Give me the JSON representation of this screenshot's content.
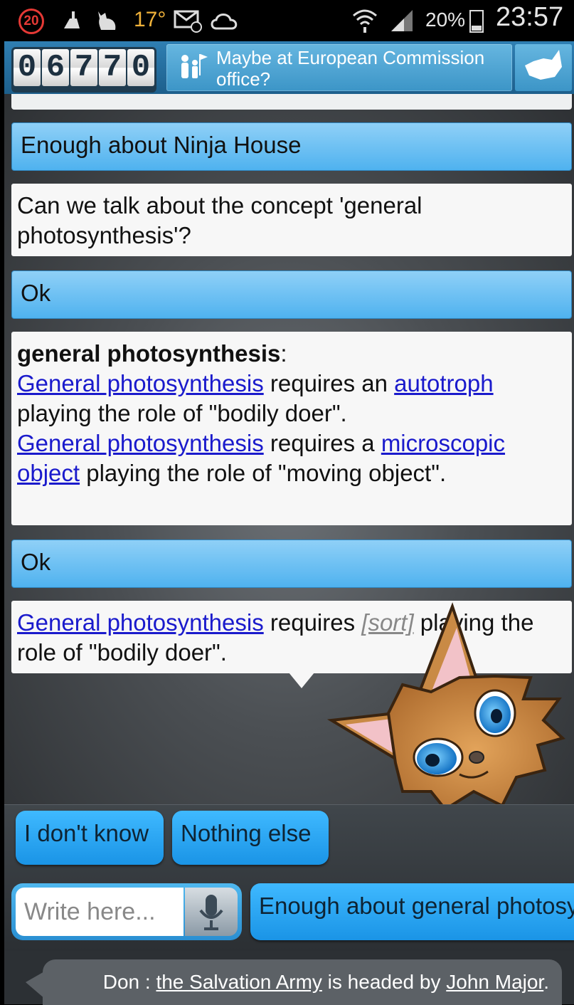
{
  "status_bar": {
    "notification_count": "20",
    "temperature": "17°",
    "battery": "20%",
    "time": "23:57",
    "icons": [
      "notification-badge-icon",
      "cleaner-icon",
      "cat-silhouette-icon",
      "weather-icon",
      "email-icon",
      "cloud-icon",
      "wifi-icon",
      "signal-icon",
      "battery-icon"
    ]
  },
  "header": {
    "counter_digits": [
      "0",
      "6",
      "7",
      "7",
      "0"
    ],
    "location": "Maybe at European Commission office?"
  },
  "conversation": {
    "msg1": "Enough about Ninja House",
    "msg2": "Can we talk about the concept 'general photosynthesis'?",
    "msg3": "Ok",
    "msg4": {
      "heading": "general photosynthesis",
      "line1_link": "General photosynthesis",
      "line1_text": " requires an ",
      "line1_link2": "autotroph",
      "line1_tail": " playing the role of \"bodily doer\".",
      "line2_link": "General photosynthesis",
      "line2_text": " requires a ",
      "line2_link2": "microscopic object",
      "line2_tail": " playing the role of \"moving object\"."
    },
    "msg5": "Ok",
    "msg6": {
      "link": "General photosynthesis",
      "text1": " requires ",
      "placeholder": "[sort]",
      "text2": " playing the role of \"bodily doer\"."
    }
  },
  "quick_replies": {
    "dont_know": "I don't know",
    "nothing_else": "Nothing else",
    "enough_about": "Enough about general photosynthesis"
  },
  "input": {
    "placeholder": "Write here..."
  },
  "footer": {
    "speaker": "Don : ",
    "link1": "the Salvation Army",
    "middle": " is headed by ",
    "link2": "John Major",
    "end": "."
  }
}
